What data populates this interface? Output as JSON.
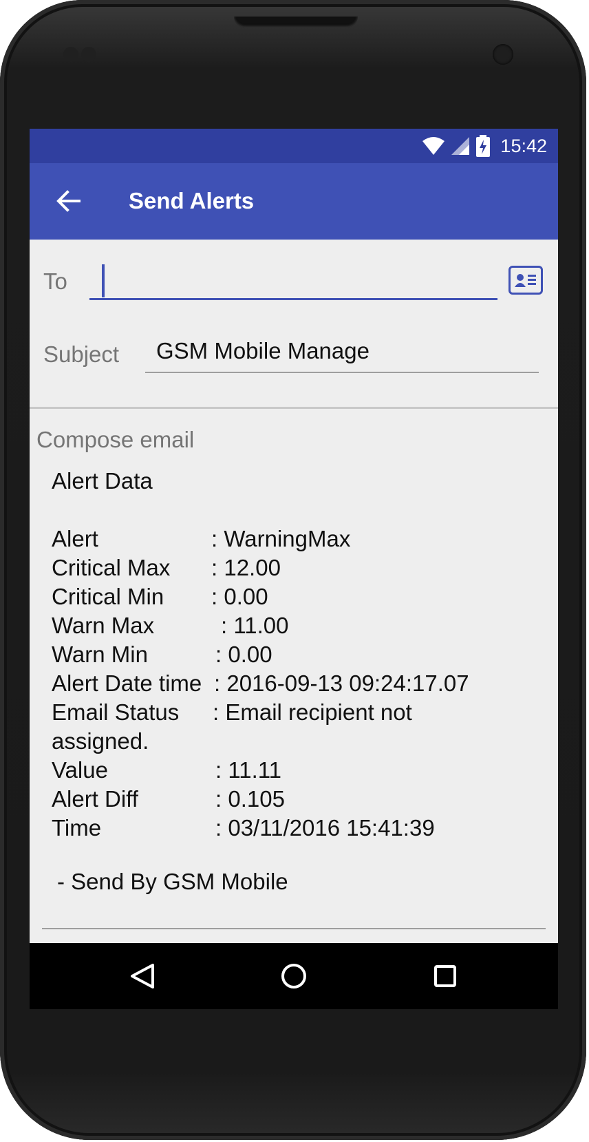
{
  "status_bar": {
    "time": "15:42",
    "icons": [
      "wifi-icon",
      "cell-signal-icon",
      "battery-charging-icon"
    ]
  },
  "app_bar": {
    "title": "Send Alerts",
    "back_icon": "arrow-back-icon"
  },
  "form": {
    "to_label": "To",
    "to_value": "",
    "contact_icon": "contact-card-icon",
    "subject_label": "Subject",
    "subject_value": "GSM Mobile Manage",
    "compose_label": "Compose email"
  },
  "email_body": {
    "heading": "Alert Data",
    "rows": [
      {
        "key": "Alert",
        "value": ": WarningMax"
      },
      {
        "key": "Critical Max",
        "value": ": 12.00"
      },
      {
        "key": "Critical Min",
        "value": ": 0.00"
      },
      {
        "key": "Warn Max",
        "value": ": 11.00"
      },
      {
        "key": "Warn Min",
        "value": ": 0.00"
      },
      {
        "key": "Alert Date time",
        "value": ": 2016-09-13 09:24:17.07"
      },
      {
        "key": "Email Status",
        "value": ": Email recipient not",
        "continuation": "assigned."
      },
      {
        "key": "Value",
        "value": ": 11.11"
      },
      {
        "key": "Alert Diff",
        "value": ": 0.105"
      },
      {
        "key": "Time",
        "value": ": 03/11/2016 15:41:39"
      }
    ],
    "signature": "- Send By GSM Mobile"
  },
  "nav_bar": {
    "buttons": [
      "back-triangle-icon",
      "home-circle-icon",
      "recents-square-icon"
    ]
  },
  "colors": {
    "status_bar": "#303f9f",
    "app_bar": "#3f51b5",
    "accent": "#3f51b5",
    "background": "#eeeeee"
  }
}
